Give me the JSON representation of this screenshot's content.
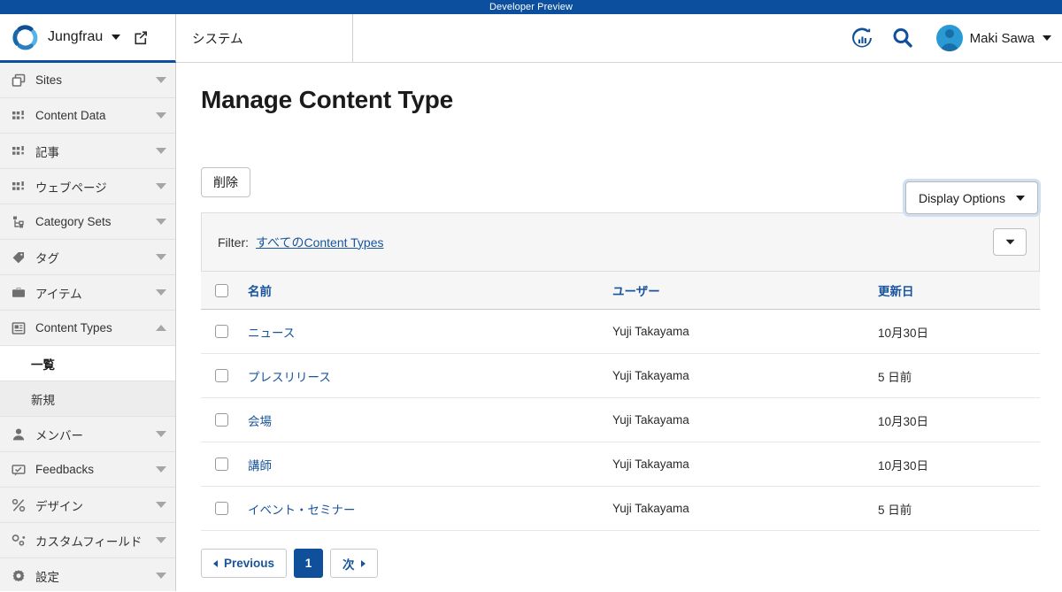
{
  "banner": {
    "text": "Developer Preview"
  },
  "header": {
    "brand_name": "Jungfrau",
    "edit_icon": "external-link-edit-icon",
    "system_tab": "システム",
    "stats_icon": "analytics-refresh-icon",
    "search_icon": "search-icon",
    "user_name": "Maki Sawa",
    "avatar_icon": "user-avatar-icon"
  },
  "sidebar": {
    "items": [
      {
        "label": "Sites",
        "icon": "sites-icon",
        "arrow": "down"
      },
      {
        "label": "Content Data",
        "icon": "grid-icon",
        "arrow": "down"
      },
      {
        "label": "記事",
        "icon": "grid-icon",
        "arrow": "down"
      },
      {
        "label": "ウェブページ",
        "icon": "grid-icon",
        "arrow": "down"
      },
      {
        "label": "Category Sets",
        "icon": "category-tree-icon",
        "arrow": "down"
      },
      {
        "label": "タグ",
        "icon": "tag-icon",
        "arrow": "down"
      },
      {
        "label": "アイテム",
        "icon": "briefcase-icon",
        "arrow": "down"
      },
      {
        "label": "Content Types",
        "icon": "content-type-icon",
        "arrow": "up"
      }
    ],
    "sub_items": [
      {
        "label": "一覧",
        "active": true
      },
      {
        "label": "新規",
        "active": false
      }
    ],
    "items_after": [
      {
        "label": "メンバー",
        "icon": "person-icon",
        "arrow": "down"
      },
      {
        "label": "Feedbacks",
        "icon": "comment-icon",
        "arrow": "down"
      },
      {
        "label": "デザイン",
        "icon": "design-icon",
        "arrow": "down"
      },
      {
        "label": "カスタムフィールド",
        "icon": "custom-field-icon",
        "arrow": "down"
      },
      {
        "label": "設定",
        "icon": "gear-icon",
        "arrow": "down"
      }
    ]
  },
  "main": {
    "page_title": "Manage Content Type",
    "display_options_label": "Display Options",
    "delete_label": "削除",
    "filter_label": "Filter:",
    "filter_value": "すべてのContent Types",
    "filter_dropdown_icon": "chevron-down-icon"
  },
  "table": {
    "columns": [
      "名前",
      "ユーザー",
      "更新日"
    ],
    "rows": [
      {
        "name": "ニュース",
        "user": "Yuji Takayama",
        "updated": "10月30日"
      },
      {
        "name": "プレスリリース",
        "user": "Yuji Takayama",
        "updated": "5 日前"
      },
      {
        "name": "会場",
        "user": "Yuji Takayama",
        "updated": "10月30日"
      },
      {
        "name": "講師",
        "user": "Yuji Takayama",
        "updated": "10月30日"
      },
      {
        "name": "イベント・セミナー",
        "user": "Yuji Takayama",
        "updated": "5 日前"
      }
    ]
  },
  "pagination": {
    "previous_label": "Previous",
    "current_page": "1",
    "next_label": "次"
  },
  "colors": {
    "banner_blue": "#0b4f9e",
    "link_blue": "#18549c",
    "active_page_blue": "#10509b",
    "sidebar_bg": "#f2f2f2",
    "focus_ring": "#cfe0f3"
  }
}
